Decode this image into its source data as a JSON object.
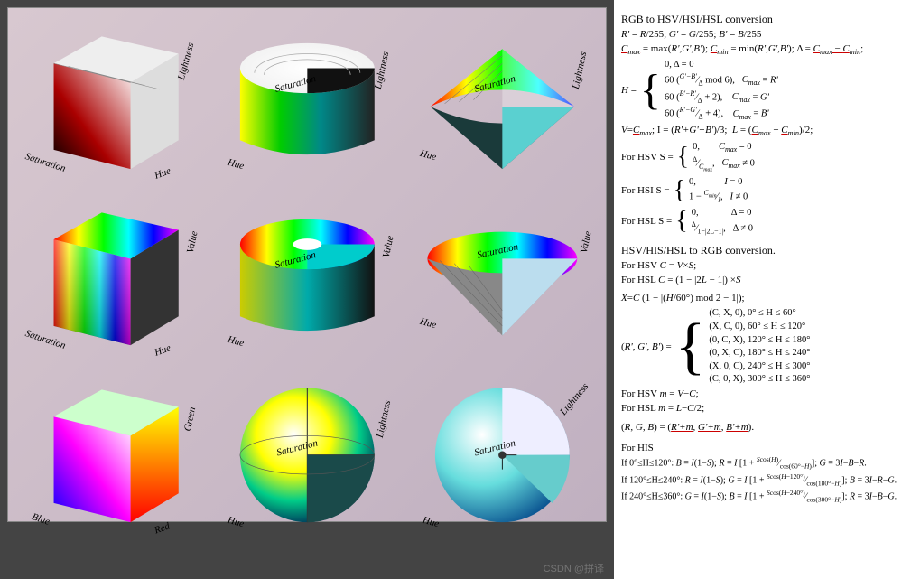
{
  "diagram": {
    "grid": [
      {
        "row": 0,
        "col": 0,
        "shape": "cube",
        "style": "greyred",
        "axes": [
          "Saturation",
          "Hue",
          "Lightness"
        ]
      },
      {
        "row": 0,
        "col": 1,
        "shape": "cylinder",
        "style": "white-top",
        "axes": [
          "Hue",
          "Saturation",
          "Lightness"
        ]
      },
      {
        "row": 0,
        "col": 2,
        "shape": "cone",
        "style": "rainbow",
        "axes": [
          "Hue",
          "Saturation",
          "Lightness"
        ]
      },
      {
        "row": 1,
        "col": 0,
        "shape": "cube",
        "style": "rainbow",
        "axes": [
          "Saturation",
          "Hue",
          "Value"
        ]
      },
      {
        "row": 1,
        "col": 1,
        "shape": "cylinder",
        "style": "rainbow",
        "axes": [
          "Hue",
          "Saturation",
          "Value"
        ]
      },
      {
        "row": 1,
        "col": 2,
        "shape": "cone",
        "style": "flat",
        "axes": [
          "Hue",
          "Saturation",
          "Value"
        ]
      },
      {
        "row": 2,
        "col": 0,
        "shape": "cube",
        "style": "rgb",
        "axes": [
          "Blue",
          "Red",
          "Green"
        ]
      },
      {
        "row": 2,
        "col": 1,
        "shape": "sphere",
        "style": "rainbow",
        "axes": [
          "Hue",
          "Saturation",
          "Lightness"
        ]
      },
      {
        "row": 2,
        "col": 2,
        "shape": "sphere",
        "style": "cutopen",
        "axes": [
          "Hue",
          "Saturation",
          "Lightness"
        ]
      }
    ]
  },
  "formulas": {
    "heading1": "RGB to HSV/HSI/HSL conversion",
    "norm": "R' = R/255; G' = G/255; B' = B/255",
    "cmax": "Cmax = max(R',G',B'); Cmin = min(R',G',B'); Δ = Cmax − Cmin;",
    "h_intro": "H =",
    "h_cases": [
      "0,                             Δ = 0",
      "60 ((G'−B')/Δ mod 6),   Cmax = R'",
      "60 ((B'−R')/Δ + 2),       Cmax = G'",
      "60 ((R'−G')/Δ + 4),       Cmax = B'"
    ],
    "vil": "V = Cmax; I = (R'+G'+B')/3;  L = (Cmax + Cmin)/2;",
    "s_hsv_intro": "For HSV S =",
    "s_hsv_cases": [
      "0,           Cmax = 0",
      "Δ / Cmax,  Cmax ≠ 0"
    ],
    "s_hsi_intro": "For HSI  S =",
    "s_hsi_cases": [
      "0,               I = 0",
      "1 − Cmin / I,  I ≠ 0"
    ],
    "s_hsl_intro": "For HSL  S =",
    "s_hsl_cases": [
      "0,                   Δ = 0",
      "Δ / (1−|2L−1|),  Δ ≠ 0"
    ],
    "heading2": "HSV/HIS/HSL to RGB conversion.",
    "c_hsv": "For HSV C = V × S;",
    "c_hsl": "For HSL C = (1 − |2L − 1|) × S",
    "x": "X = C (1 − |(H/60°) mod 2 − 1|);",
    "rgbp_intro": "(R', G', B') =",
    "rgbp_cases": [
      "(C, X, 0),    0° ≤ H ≤ 60°",
      "(X, C, 0),    60° ≤ H ≤ 120°",
      "(0, C, X),    120° ≤ H ≤ 180°",
      "(0, X, C),    180° ≤ H ≤ 240°",
      "(X, 0, C),    240° ≤ H ≤ 300°",
      "(C, 0, X),    300° ≤ H ≤ 360°"
    ],
    "m_hsv": "For HSV m = V − C;",
    "m_hsl": "For HSL m = L − C/2;",
    "rgb_final": "(R, G, B) = (R'+m, G'+m, B'+m).",
    "his_heading": "For HIS",
    "his_lines": [
      "If 0°≤H≤120°: B = I(1−S); R = I [1 + S cos(H) / cos(60°−H)]; G = 3I−B−R.",
      "If 120°≤H≤240°: R = I(1−S); G = I [1 + S cos(H−120°) / cos(180°−H)]; B = 3I−R−G.",
      "If 240°≤H≤360°: G = I(1−S); B = I [1 + S cos(H−240°) / cos(300°−H)]; R = 3I−B−G."
    ]
  },
  "watermark": "CSDN @拼译"
}
